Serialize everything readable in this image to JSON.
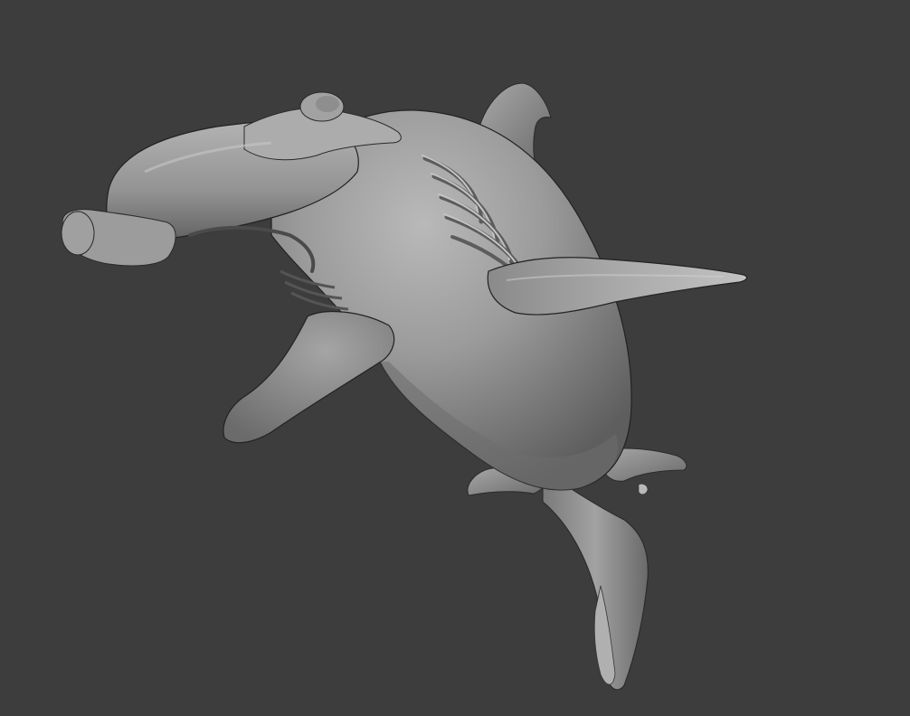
{
  "viewport": {
    "background": "#3d3d3d",
    "object": "hammerhead-shark-sculpt",
    "material_base": "#9a9a9a",
    "material_highlight": "#bdbdbd",
    "material_shadow": "#4a4a4a",
    "outline": "#222222"
  }
}
